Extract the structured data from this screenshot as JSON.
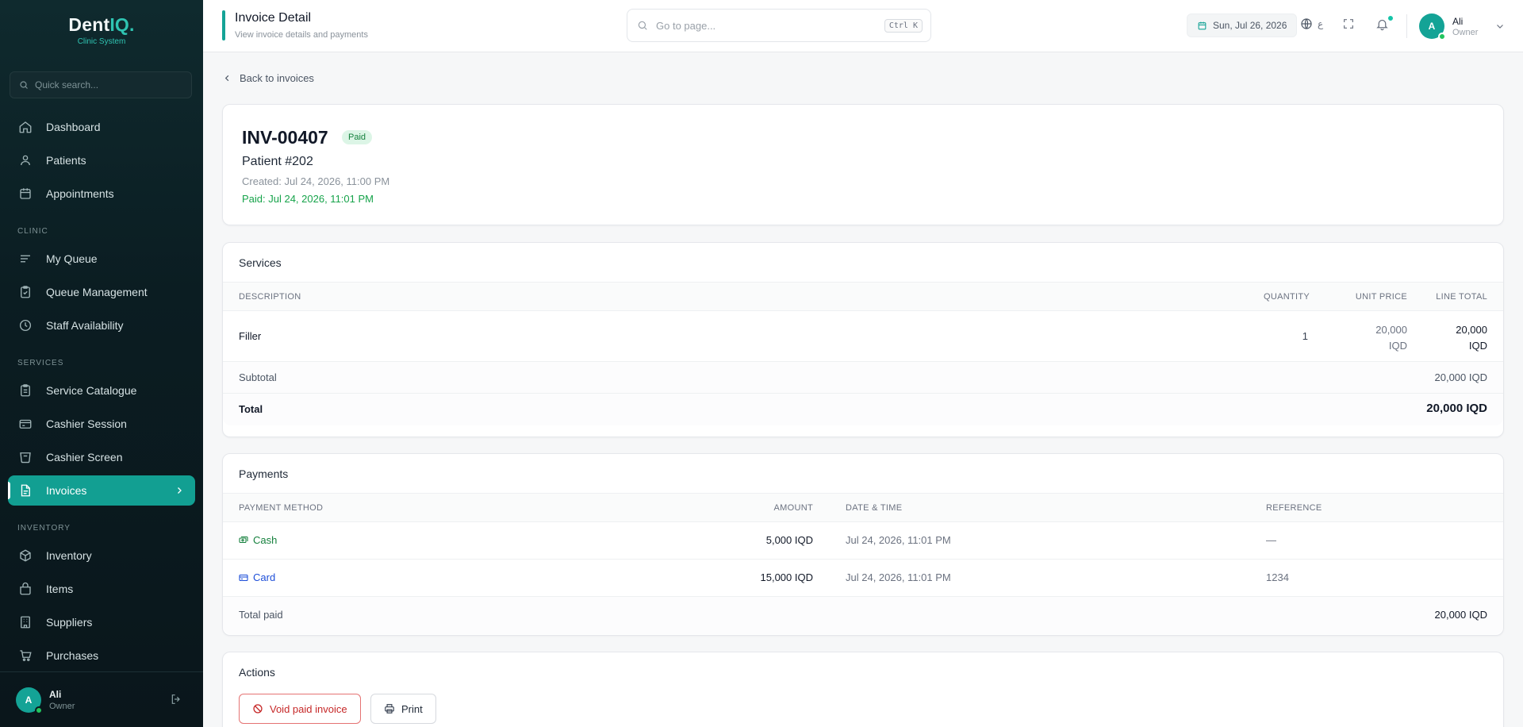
{
  "sidebar": {
    "logo": {
      "main": "Dent",
      "accent": "IQ."
    },
    "logo_sub": "Clinic System",
    "search_placeholder": "Quick search...",
    "items": [
      {
        "label": "Dashboard",
        "icon": "home-icon"
      },
      {
        "label": "Patients",
        "icon": "users-icon"
      },
      {
        "label": "Appointments",
        "icon": "calendar-icon"
      }
    ],
    "section_clinic": "CLINIC",
    "clinic_items": [
      {
        "label": "My Queue",
        "icon": "list-icon"
      },
      {
        "label": "Queue Management",
        "icon": "clipboard-icon"
      },
      {
        "label": "Staff Availability",
        "icon": "clock-icon"
      }
    ],
    "section_services": "SERVICES",
    "services_items": [
      {
        "label": "Service Catalogue",
        "icon": "clipboard-list-icon"
      },
      {
        "label": "Cashier Session",
        "icon": "wallet-icon"
      },
      {
        "label": "Cashier Screen",
        "icon": "calculator-icon"
      },
      {
        "label": "Invoices",
        "icon": "document-icon",
        "active": true
      }
    ],
    "section_inventory": "INVENTORY",
    "inventory_items": [
      {
        "label": "Inventory",
        "icon": "box-icon"
      },
      {
        "label": "Items",
        "icon": "package-icon"
      },
      {
        "label": "Suppliers",
        "icon": "building-icon"
      },
      {
        "label": "Purchases",
        "icon": "cart-icon"
      }
    ],
    "footer": {
      "avatar": "A",
      "name": "Ali",
      "role": "Owner"
    }
  },
  "topbar": {
    "title": "Invoice Detail",
    "subtitle": "View invoice details and payments",
    "goto_placeholder": "Go to page...",
    "shortcut": "Ctrl K",
    "date": "Sun, Jul 26, 2026",
    "lang": "ع",
    "user": {
      "avatar": "A",
      "name": "Ali",
      "role": "Owner"
    }
  },
  "main": {
    "back_label": "Back to invoices",
    "invoice": {
      "id": "INV-00407",
      "status": "Paid",
      "patient": "Patient #202",
      "created": "Created: Jul 24, 2026, 11:00 PM",
      "paid": "Paid: Jul 24, 2026, 11:01 PM"
    },
    "services": {
      "title": "Services",
      "columns": {
        "description": "DESCRIPTION",
        "quantity": "QUANTITY",
        "unit_price": "UNIT PRICE",
        "line_total": "LINE TOTAL"
      },
      "rows": [
        {
          "description": "Filler",
          "quantity": "1",
          "unit_price_amount": "20,000",
          "unit_price_currency": "IQD",
          "line_total_amount": "20,000",
          "line_total_currency": "IQD"
        }
      ],
      "subtotal_label": "Subtotal",
      "subtotal_value": "20,000 IQD",
      "total_label": "Total",
      "total_value": "20,000 IQD"
    },
    "payments": {
      "title": "Payments",
      "columns": {
        "method": "PAYMENT METHOD",
        "amount": "AMOUNT",
        "datetime": "DATE & TIME",
        "reference": "REFERENCE"
      },
      "rows": [
        {
          "method": "Cash",
          "amount": "5,000 IQD",
          "datetime": "Jul 24, 2026, 11:01 PM",
          "reference": "—",
          "color": "#15803d"
        },
        {
          "method": "Card",
          "amount": "15,000 IQD",
          "datetime": "Jul 24, 2026, 11:01 PM",
          "reference": "1234",
          "color": "#1d4ed8"
        }
      ],
      "total_label": "Total paid",
      "total_value": "20,000 IQD"
    },
    "actions": {
      "title": "Actions",
      "void_label": "Void paid invoice",
      "print_label": "Print"
    }
  },
  "colors": {
    "accent": "#14a396",
    "paid_green": "#16a34a",
    "danger": "#c62828",
    "sidebar_bg": "#0f2a2e"
  }
}
